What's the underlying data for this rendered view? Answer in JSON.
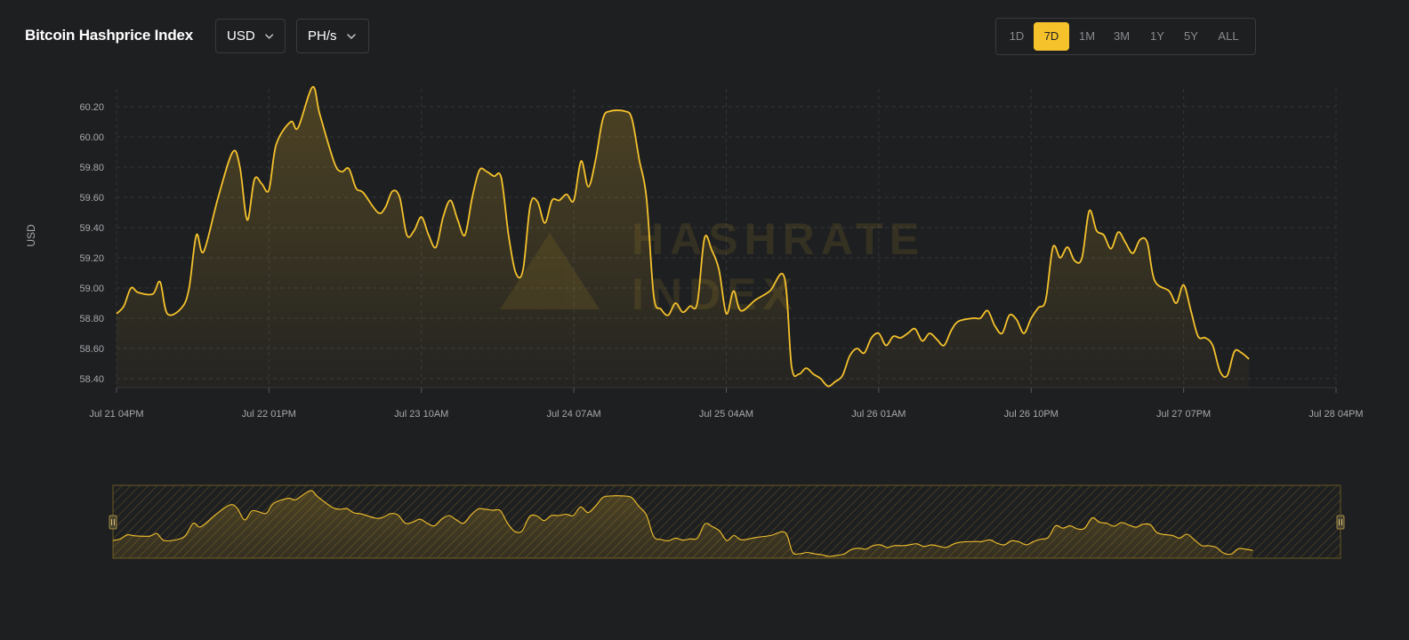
{
  "header": {
    "title": "Bitcoin Hashprice Index",
    "currency": {
      "selected": "USD"
    },
    "unit": {
      "selected": "PH/s"
    },
    "ranges": [
      {
        "label": "1D",
        "active": false
      },
      {
        "label": "7D",
        "active": true
      },
      {
        "label": "1M",
        "active": false
      },
      {
        "label": "3M",
        "active": false
      },
      {
        "label": "1Y",
        "active": false
      },
      {
        "label": "5Y",
        "active": false
      },
      {
        "label": "ALL",
        "active": false
      }
    ]
  },
  "watermark": {
    "line1": "HASHRATE",
    "line2": "INDEX"
  },
  "colors": {
    "background": "#1e1f21",
    "line": "#f5c22c",
    "accent": "#f5c22c",
    "grid": "#34353a",
    "tick_text": "#a7a8ac"
  },
  "chart_data": {
    "type": "area",
    "title": "Bitcoin Hashprice Index",
    "xlabel": "",
    "ylabel": "USD",
    "ylim": [
      58.4,
      60.2
    ],
    "yticks": [
      60.2,
      60.0,
      59.8,
      59.6,
      59.4,
      59.2,
      59.0,
      58.8,
      58.6,
      58.4
    ],
    "ytick_labels": [
      "60.20",
      "60.00",
      "59.80",
      "59.60",
      "59.40",
      "59.20",
      "59.00",
      "58.80",
      "58.60",
      "58.40"
    ],
    "xlim": [
      0,
      168
    ],
    "xticks": [
      0,
      21,
      42,
      63,
      84,
      105,
      126,
      147,
      168
    ],
    "xtick_labels": [
      "Jul 21 04PM",
      "Jul 22 01PM",
      "Jul 23 10AM",
      "Jul 24 07AM",
      "Jul 25 04AM",
      "Jul 26 01AM",
      "Jul 26 10PM",
      "Jul 27 07PM",
      "Jul 28 04PM"
    ],
    "grid": true,
    "series": [
      {
        "values": [
          [
            0,
            58.83
          ],
          [
            1,
            58.88
          ],
          [
            2,
            59.0
          ],
          [
            3,
            58.97
          ],
          [
            5,
            58.96
          ],
          [
            6,
            59.04
          ],
          [
            7,
            58.83
          ],
          [
            9,
            58.87
          ],
          [
            10,
            59.0
          ],
          [
            11,
            59.35
          ],
          [
            12,
            59.24
          ],
          [
            14,
            59.6
          ],
          [
            16,
            59.9
          ],
          [
            17,
            59.8
          ],
          [
            18,
            59.45
          ],
          [
            19,
            59.72
          ],
          [
            20,
            59.69
          ],
          [
            21,
            59.65
          ],
          [
            22,
            59.95
          ],
          [
            24,
            60.1
          ],
          [
            25,
            60.06
          ],
          [
            27,
            60.33
          ],
          [
            28,
            60.15
          ],
          [
            30,
            59.83
          ],
          [
            31,
            59.77
          ],
          [
            32,
            59.79
          ],
          [
            33,
            59.66
          ],
          [
            34,
            59.63
          ],
          [
            36,
            59.5
          ],
          [
            37,
            59.53
          ],
          [
            38,
            59.64
          ],
          [
            39,
            59.6
          ],
          [
            40,
            59.35
          ],
          [
            41,
            59.38
          ],
          [
            42,
            59.47
          ],
          [
            43,
            59.35
          ],
          [
            44,
            59.27
          ],
          [
            45,
            59.47
          ],
          [
            46,
            59.58
          ],
          [
            47,
            59.45
          ],
          [
            48,
            59.35
          ],
          [
            49,
            59.6
          ],
          [
            50,
            59.78
          ],
          [
            51,
            59.77
          ],
          [
            52,
            59.74
          ],
          [
            53,
            59.73
          ],
          [
            54,
            59.35
          ],
          [
            55,
            59.1
          ],
          [
            56,
            59.12
          ],
          [
            57,
            59.55
          ],
          [
            58,
            59.57
          ],
          [
            59,
            59.43
          ],
          [
            60,
            59.58
          ],
          [
            61,
            59.58
          ],
          [
            62,
            59.62
          ],
          [
            63,
            59.58
          ],
          [
            64,
            59.84
          ],
          [
            65,
            59.67
          ],
          [
            66,
            59.85
          ],
          [
            67,
            60.12
          ],
          [
            68,
            60.17
          ],
          [
            70,
            60.17
          ],
          [
            71,
            60.12
          ],
          [
            72,
            59.85
          ],
          [
            73,
            59.6
          ],
          [
            74,
            58.95
          ],
          [
            75,
            58.86
          ],
          [
            76,
            58.82
          ],
          [
            77,
            58.9
          ],
          [
            78,
            58.84
          ],
          [
            79,
            58.88
          ],
          [
            80,
            58.9
          ],
          [
            81,
            59.33
          ],
          [
            82,
            59.25
          ],
          [
            83,
            59.12
          ],
          [
            84,
            58.83
          ],
          [
            85,
            58.98
          ],
          [
            86,
            58.85
          ],
          [
            88,
            58.92
          ],
          [
            90,
            58.98
          ],
          [
            92,
            59.07
          ],
          [
            93,
            58.48
          ],
          [
            94,
            58.43
          ],
          [
            95,
            58.47
          ],
          [
            96,
            58.43
          ],
          [
            97,
            58.4
          ],
          [
            98,
            58.35
          ],
          [
            99,
            58.38
          ],
          [
            100,
            58.42
          ],
          [
            101,
            58.55
          ],
          [
            102,
            58.6
          ],
          [
            103,
            58.57
          ],
          [
            104,
            58.67
          ],
          [
            105,
            58.7
          ],
          [
            106,
            58.62
          ],
          [
            107,
            58.68
          ],
          [
            108,
            58.67
          ],
          [
            109,
            58.7
          ],
          [
            110,
            58.73
          ],
          [
            111,
            58.65
          ],
          [
            112,
            58.7
          ],
          [
            113,
            58.66
          ],
          [
            114,
            58.62
          ],
          [
            115,
            58.72
          ],
          [
            116,
            58.78
          ],
          [
            118,
            58.8
          ],
          [
            119,
            58.8
          ],
          [
            120,
            58.85
          ],
          [
            121,
            58.75
          ],
          [
            122,
            58.7
          ],
          [
            123,
            58.82
          ],
          [
            124,
            58.79
          ],
          [
            125,
            58.7
          ],
          [
            126,
            58.8
          ],
          [
            127,
            58.87
          ],
          [
            128,
            58.92
          ],
          [
            129,
            59.27
          ],
          [
            130,
            59.2
          ],
          [
            131,
            59.27
          ],
          [
            132,
            59.18
          ],
          [
            133,
            59.2
          ],
          [
            134,
            59.51
          ],
          [
            135,
            59.38
          ],
          [
            136,
            59.35
          ],
          [
            137,
            59.26
          ],
          [
            138,
            59.37
          ],
          [
            139,
            59.3
          ],
          [
            140,
            59.23
          ],
          [
            141,
            59.32
          ],
          [
            142,
            59.3
          ],
          [
            143,
            59.05
          ],
          [
            145,
            58.98
          ],
          [
            146,
            58.9
          ],
          [
            147,
            59.02
          ],
          [
            148,
            58.85
          ],
          [
            149,
            58.68
          ],
          [
            150,
            58.67
          ],
          [
            151,
            58.62
          ],
          [
            152,
            58.45
          ],
          [
            153,
            58.42
          ],
          [
            154,
            58.58
          ],
          [
            155,
            58.57
          ],
          [
            156,
            58.53
          ]
        ]
      }
    ]
  }
}
